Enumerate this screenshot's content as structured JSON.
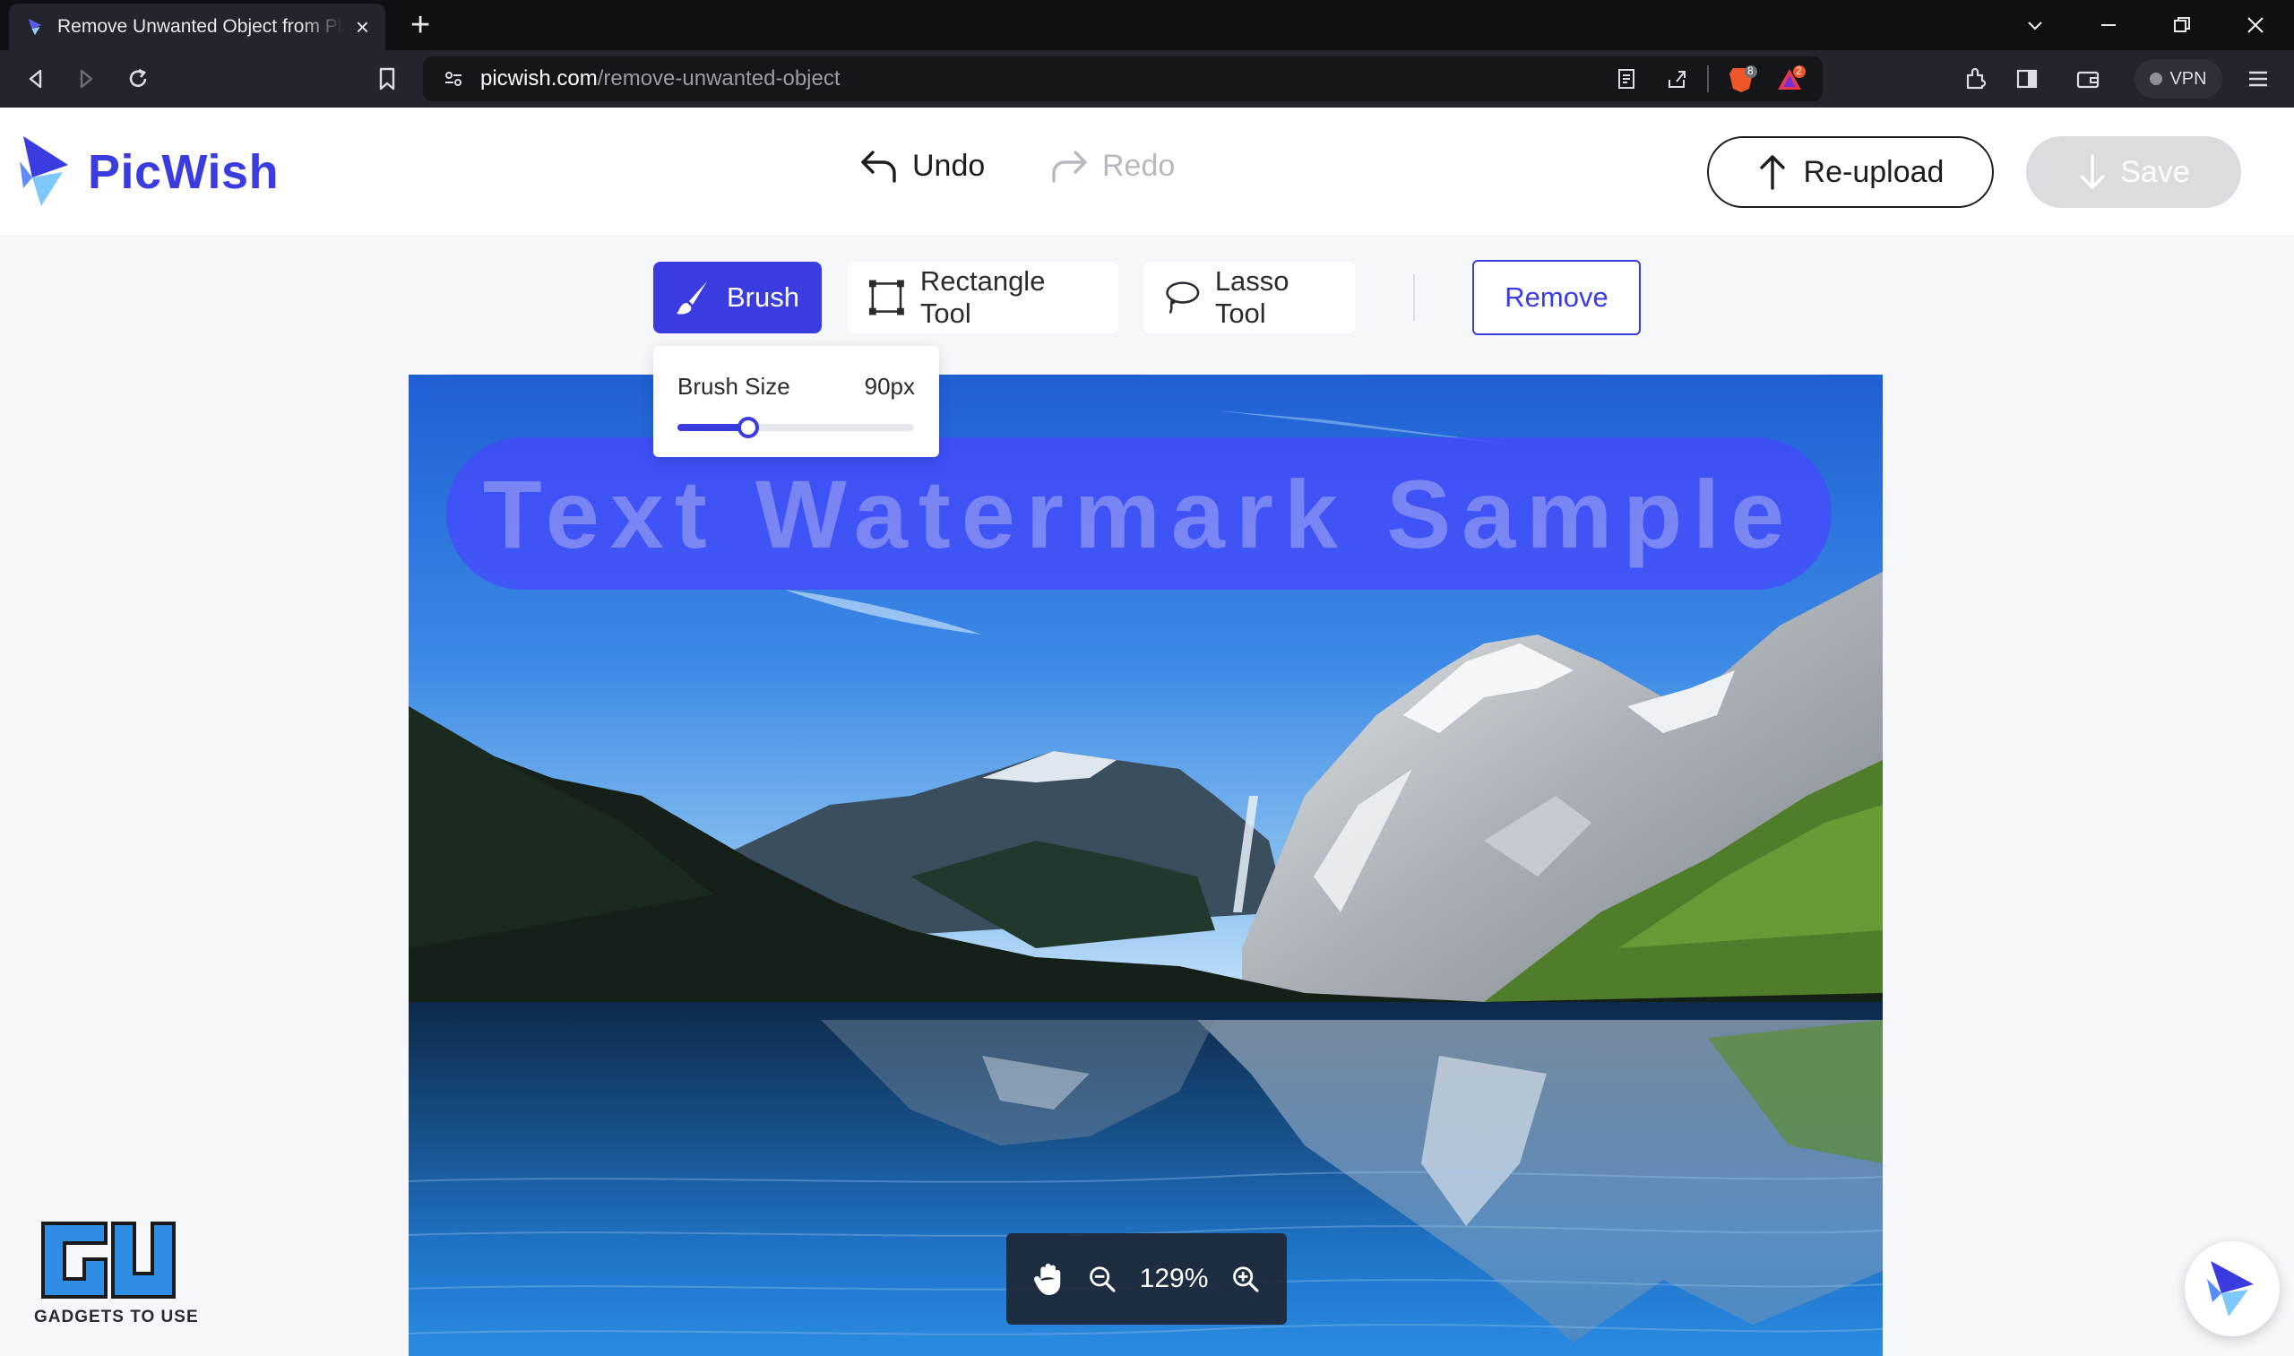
{
  "browser": {
    "tab_title": "Remove Unwanted Object from Photo",
    "url_host": "picwish.com",
    "url_path": "/remove-unwanted-object",
    "shields_count": "8",
    "rewards_count": "2",
    "vpn_label": "VPN"
  },
  "app": {
    "brand_name": "PicWish",
    "undo_label": "Undo",
    "redo_label": "Redo",
    "reupload_label": "Re-upload",
    "save_label": "Save"
  },
  "tools": {
    "brush_label": "Brush",
    "rectangle_label": "Rectangle Tool",
    "lasso_label": "Lasso Tool",
    "remove_label": "Remove",
    "active_tool": "Brush"
  },
  "brush_popover": {
    "label": "Brush Size",
    "value_text": "90px",
    "slider_fraction": 0.3
  },
  "canvas": {
    "watermark_text": "Text Watermark Sample"
  },
  "zoom": {
    "percent_text": "129%"
  },
  "overlay": {
    "gtu_caption": "GADGETS TO USE"
  },
  "colors": {
    "accent": "#3a3ce0",
    "mask": "#4646ff"
  },
  "icons": {
    "undo": "undo-arrow-icon",
    "redo": "redo-arrow-icon",
    "reupload": "upload-arrow-icon",
    "save": "download-arrow-icon",
    "brush": "brush-icon",
    "rectangle": "rectangle-select-icon",
    "lasso": "lasso-icon",
    "pan": "hand-icon",
    "zoom_out": "zoom-out-icon",
    "zoom_in": "zoom-in-icon"
  }
}
